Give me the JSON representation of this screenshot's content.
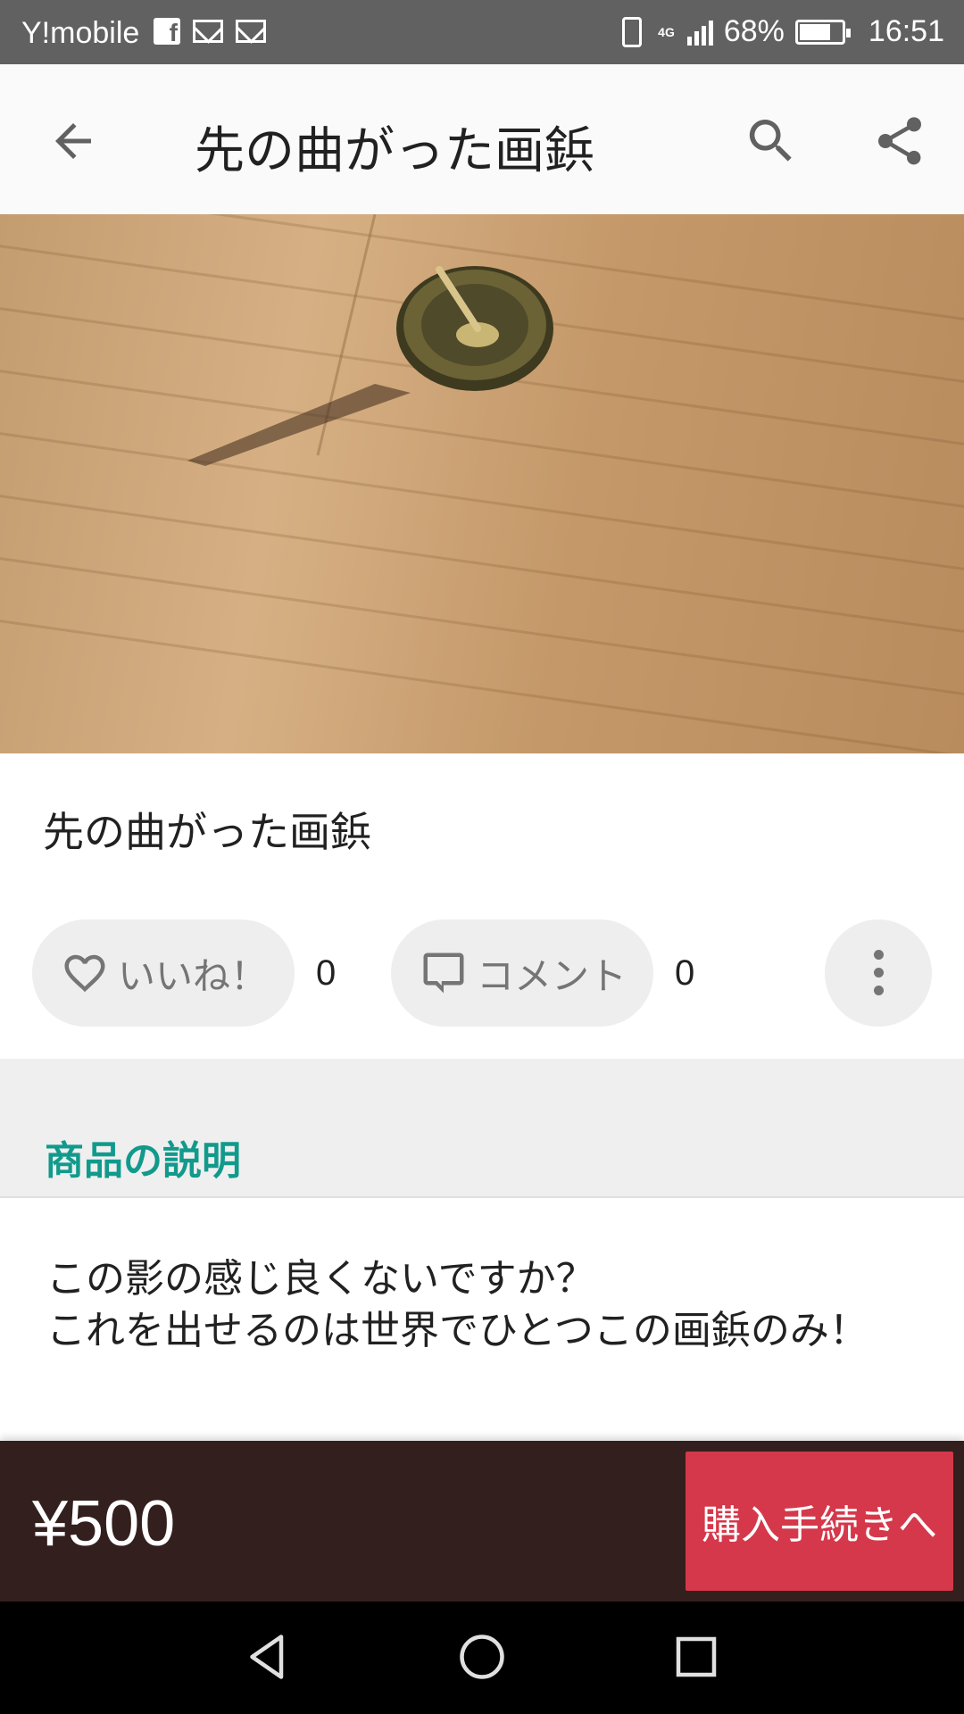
{
  "status_bar": {
    "carrier": "Y!mobile",
    "network": "4G",
    "battery": "68%",
    "time": "16:51"
  },
  "app_bar": {
    "title": "先の曲がった画鋲"
  },
  "item": {
    "title": "先の曲がった画鋲",
    "like_label": "いいね！",
    "like_count": "0",
    "comment_label": "コメント",
    "comment_count": "0"
  },
  "description_section": {
    "heading": "商品の説明",
    "text": "この影の感じ良くないですか？\nこれを出せるのは世界でひとつこの画鋲のみ！"
  },
  "purchase": {
    "price": "¥500",
    "buy_label": "購入手続きへ"
  },
  "colors": {
    "accent_teal": "#119a8c",
    "buy_button": "#d5384a",
    "buy_bar_bg": "#331f1d"
  }
}
